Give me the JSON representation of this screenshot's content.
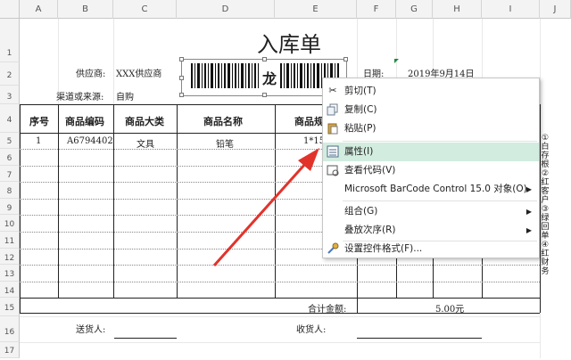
{
  "sheet": {
    "columns": [
      "A",
      "B",
      "C",
      "D",
      "E",
      "F",
      "G",
      "H",
      "I",
      "J"
    ],
    "rows": [
      "1",
      "2",
      "3",
      "4",
      "5",
      "6",
      "7",
      "8",
      "9",
      "10",
      "11",
      "12",
      "13",
      "14",
      "15",
      "16",
      "17"
    ]
  },
  "form": {
    "title": "入库单",
    "supplier_label": "供应商:",
    "supplier_value": "XXX供应商",
    "channel_label": "渠道或来源:",
    "channel_value": "自购",
    "date_label": "日期:",
    "date_value": "2019年9月14日",
    "barcode_text": "龙"
  },
  "table": {
    "headers": [
      "序号",
      "商品编码",
      "商品大类",
      "商品名称",
      "商品规"
    ],
    "rows": [
      [
        "1",
        "A6794402",
        "文具",
        "铅笔",
        "1*15"
      ]
    ],
    "total_label": "合计金额:",
    "total_value": "5.00元"
  },
  "footer": {
    "deliverer_label": "送货人:",
    "receiver_label": "收货人:"
  },
  "side_note": [
    "①",
    "白",
    "存",
    "根",
    "②",
    "红",
    "客",
    "户",
    "③",
    "绿",
    "回",
    "单",
    "④",
    "红",
    "财",
    "务"
  ],
  "context_menu": {
    "items": [
      {
        "label": "剪切(T)",
        "icon": "scissors-icon"
      },
      {
        "label": "复制(C)",
        "icon": "copy-icon"
      },
      {
        "label": "粘贴(P)",
        "icon": "paste-icon"
      },
      {
        "label": "属性(I)",
        "icon": "properties-icon"
      },
      {
        "label": "查看代码(V)",
        "icon": "view-code-icon"
      },
      {
        "label": "Microsoft BarCode Control 15.0 对象(O)",
        "icon": ""
      },
      {
        "label": "组合(G)",
        "icon": ""
      },
      {
        "label": "叠放次序(R)",
        "icon": ""
      },
      {
        "label": "设置控件格式(F)...",
        "icon": "format-control-icon"
      }
    ],
    "highlight_color": "#d2ecdf"
  },
  "annotation": {
    "arrow_color": "#e2332b"
  }
}
